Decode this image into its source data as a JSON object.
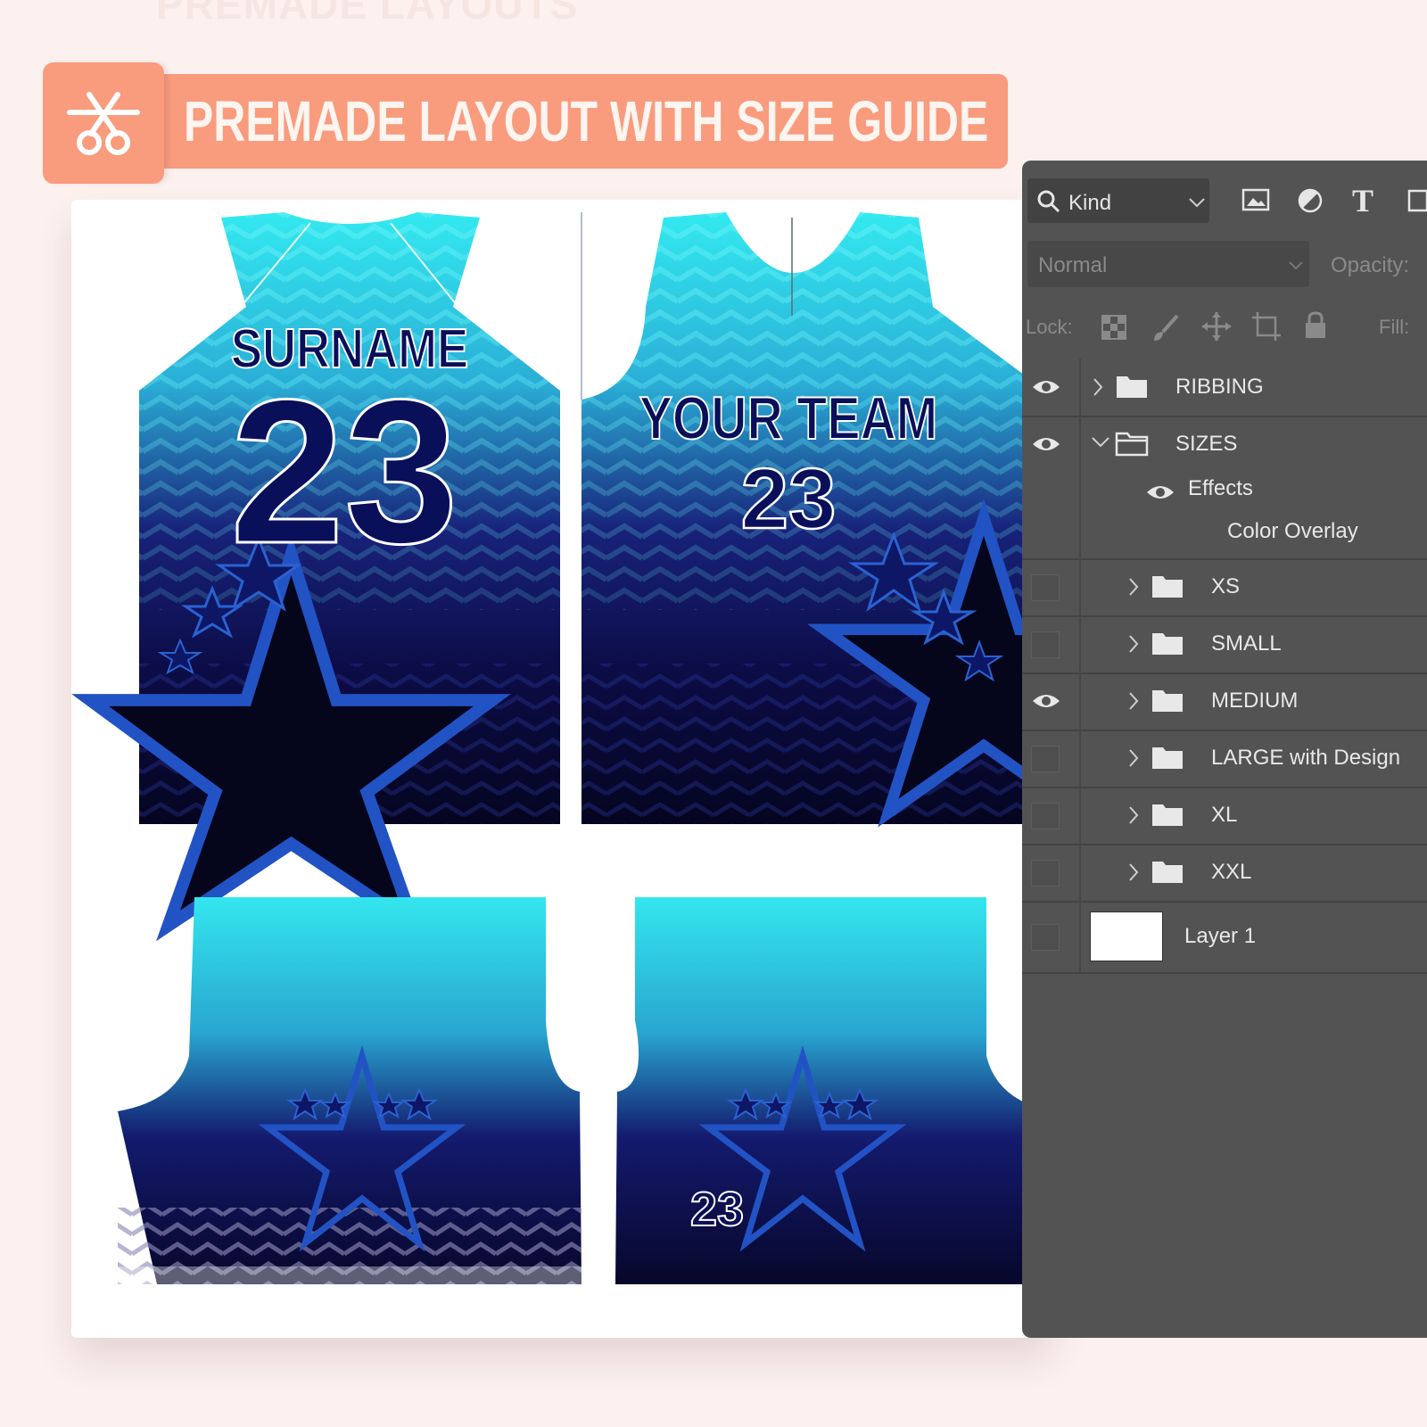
{
  "banner": {
    "ghost_text": "PREMADE LAYOUTS",
    "title": "PREMADE LAYOUT WITH SIZE GUIDE"
  },
  "jersey": {
    "back_name": "SURNAME",
    "back_number": "23",
    "front_team": "YOUR TEAM",
    "front_number": "23",
    "sleeve_number": "23"
  },
  "layers_panel": {
    "filter_kind": "Kind",
    "blend_mode": "Normal",
    "opacity_label": "Opacity:",
    "lock_label": "Lock:",
    "fill_label": "Fill:",
    "layers": [
      {
        "name": "RIBBING",
        "visible": true
      },
      {
        "name": "SIZES",
        "visible": true,
        "expanded": true
      },
      {
        "name": "Effects",
        "visible": true
      },
      {
        "name": "Color Overlay"
      },
      {
        "name": "XS",
        "visible": false
      },
      {
        "name": "SMALL",
        "visible": false
      },
      {
        "name": "MEDIUM",
        "visible": true
      },
      {
        "name": "LARGE with Design",
        "visible": false
      },
      {
        "name": "XL",
        "visible": false
      },
      {
        "name": "XXL",
        "visible": false
      },
      {
        "name": "Layer 1",
        "visible": false
      }
    ]
  },
  "colors": {
    "banner": "#f99b7d",
    "background": "#fcf1ef",
    "panel": "#535353",
    "jersey_cyan": "#2ee6ee",
    "jersey_navy": "#0b0b3a",
    "star_blue": "#1f4fb8"
  }
}
